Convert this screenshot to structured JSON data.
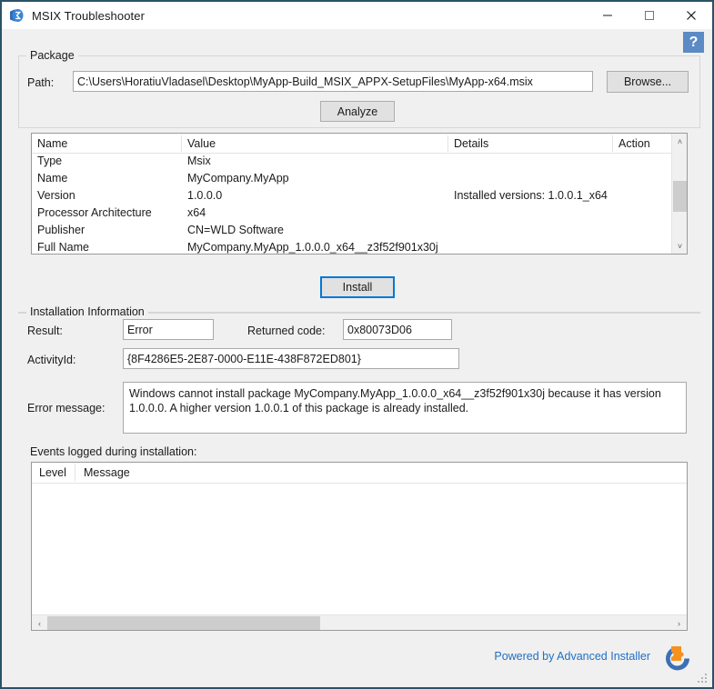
{
  "window": {
    "title": "MSIX Troubleshooter",
    "icon": "msix-app-icon",
    "minimize_label": "—",
    "maximize_label": "□",
    "close_label": "✕",
    "border_color": "#2a5266"
  },
  "help": {
    "label": "?",
    "background": "#5b8ac4"
  },
  "package": {
    "group_label": "Package",
    "path_label": "Path:",
    "path_value": "C:\\Users\\HoratiuVladasel\\Desktop\\MyApp-Build_MSIX_APPX-SetupFiles\\MyApp-x64.msix",
    "browse_label": "Browse...",
    "analyze_label": "Analyze"
  },
  "package_list": {
    "columns": [
      "Name",
      "Value",
      "Details",
      "Action"
    ],
    "rows": [
      {
        "name": "Type",
        "value": "Msix",
        "details": "",
        "action": ""
      },
      {
        "name": "Name",
        "value": "MyCompany.MyApp",
        "details": "",
        "action": ""
      },
      {
        "name": "Version",
        "value": "1.0.0.0",
        "details": "Installed versions: 1.0.0.1_x64",
        "action": ""
      },
      {
        "name": "Processor Architecture",
        "value": "x64",
        "details": "",
        "action": ""
      },
      {
        "name": "Publisher",
        "value": "CN=WLD Software",
        "details": "",
        "action": ""
      },
      {
        "name": "Full Name",
        "value": "MyCompany.MyApp_1.0.0.0_x64__z3f52f901x30j",
        "details": "",
        "action": ""
      }
    ],
    "scroll_up_glyph": "˄",
    "scroll_down_glyph": "˅"
  },
  "install": {
    "button_label": "Install",
    "focus_color": "#0078d7"
  },
  "installation_information": {
    "group_label": "Installation Information",
    "result_label": "Result:",
    "result_value": "Error",
    "returned_code_label": "Returned code:",
    "returned_code_value": "0x80073D06",
    "activity_id_label": "ActivityId:",
    "activity_id_value": "{8F4286E5-2E87-0000-E11E-438F872ED801}",
    "error_message_label": "Error message:",
    "error_message_value": "Windows cannot install package MyCompany.MyApp_1.0.0.0_x64__z3f52f901x30j because it has version 1.0.0.0. A higher version 1.0.0.1 of this package is already installed."
  },
  "events": {
    "title": "Events logged during installation:",
    "columns": [
      "Level",
      "Message"
    ],
    "rows": [],
    "scroll_left_glyph": "‹",
    "scroll_right_glyph": "›"
  },
  "footer": {
    "link_text": "Powered by Advanced Installer",
    "link_color": "#1f6fc4",
    "logo_name": "advanced-installer-logo",
    "logo_orange": "#f5921e",
    "logo_blue": "#3d6fb4"
  }
}
